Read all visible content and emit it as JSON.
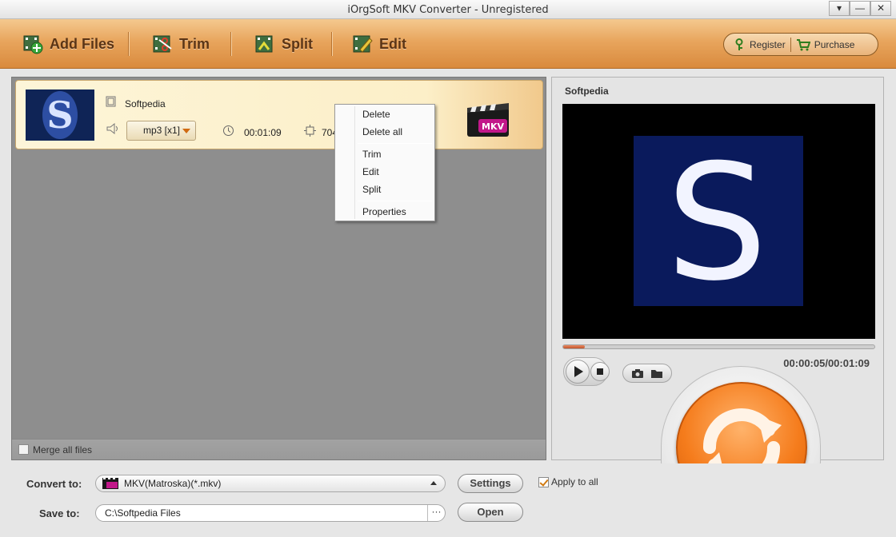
{
  "window": {
    "title": "iOrgSoft MKV Converter - Unregistered",
    "controls": [
      "▾",
      "—",
      "✕"
    ]
  },
  "toolbar": {
    "add_files": "Add Files",
    "trim": "Trim",
    "split": "Split",
    "edit": "Edit",
    "register": "Register",
    "purchase": "Purchase"
  },
  "file_list": {
    "items": [
      {
        "name": "Softpedia",
        "audio_track": "mp3 [x1]",
        "duration": "00:01:09",
        "resolution": "704",
        "format_badge": "MKV"
      }
    ],
    "merge_label": "Merge all files"
  },
  "context_menu": {
    "items": [
      "Delete",
      "Delete all",
      "Trim",
      "Edit",
      "Split",
      "Properties"
    ]
  },
  "preview": {
    "title": "Softpedia",
    "logo_letter": "S",
    "progress_fraction": 0.07,
    "timecode": "00:00:05/00:01:09"
  },
  "bottom": {
    "convert_label": "Convert to:",
    "format_value": "MKV(Matroska)(*.mkv)",
    "settings": "Settings",
    "apply_all": "Apply to all",
    "save_label": "Save to:",
    "save_path": "C:\\Softpedia Files",
    "browse": "···",
    "open": "Open"
  },
  "colors": {
    "toolbar_accent": "#e8a55d",
    "convert_orange": "#f57c1c"
  }
}
